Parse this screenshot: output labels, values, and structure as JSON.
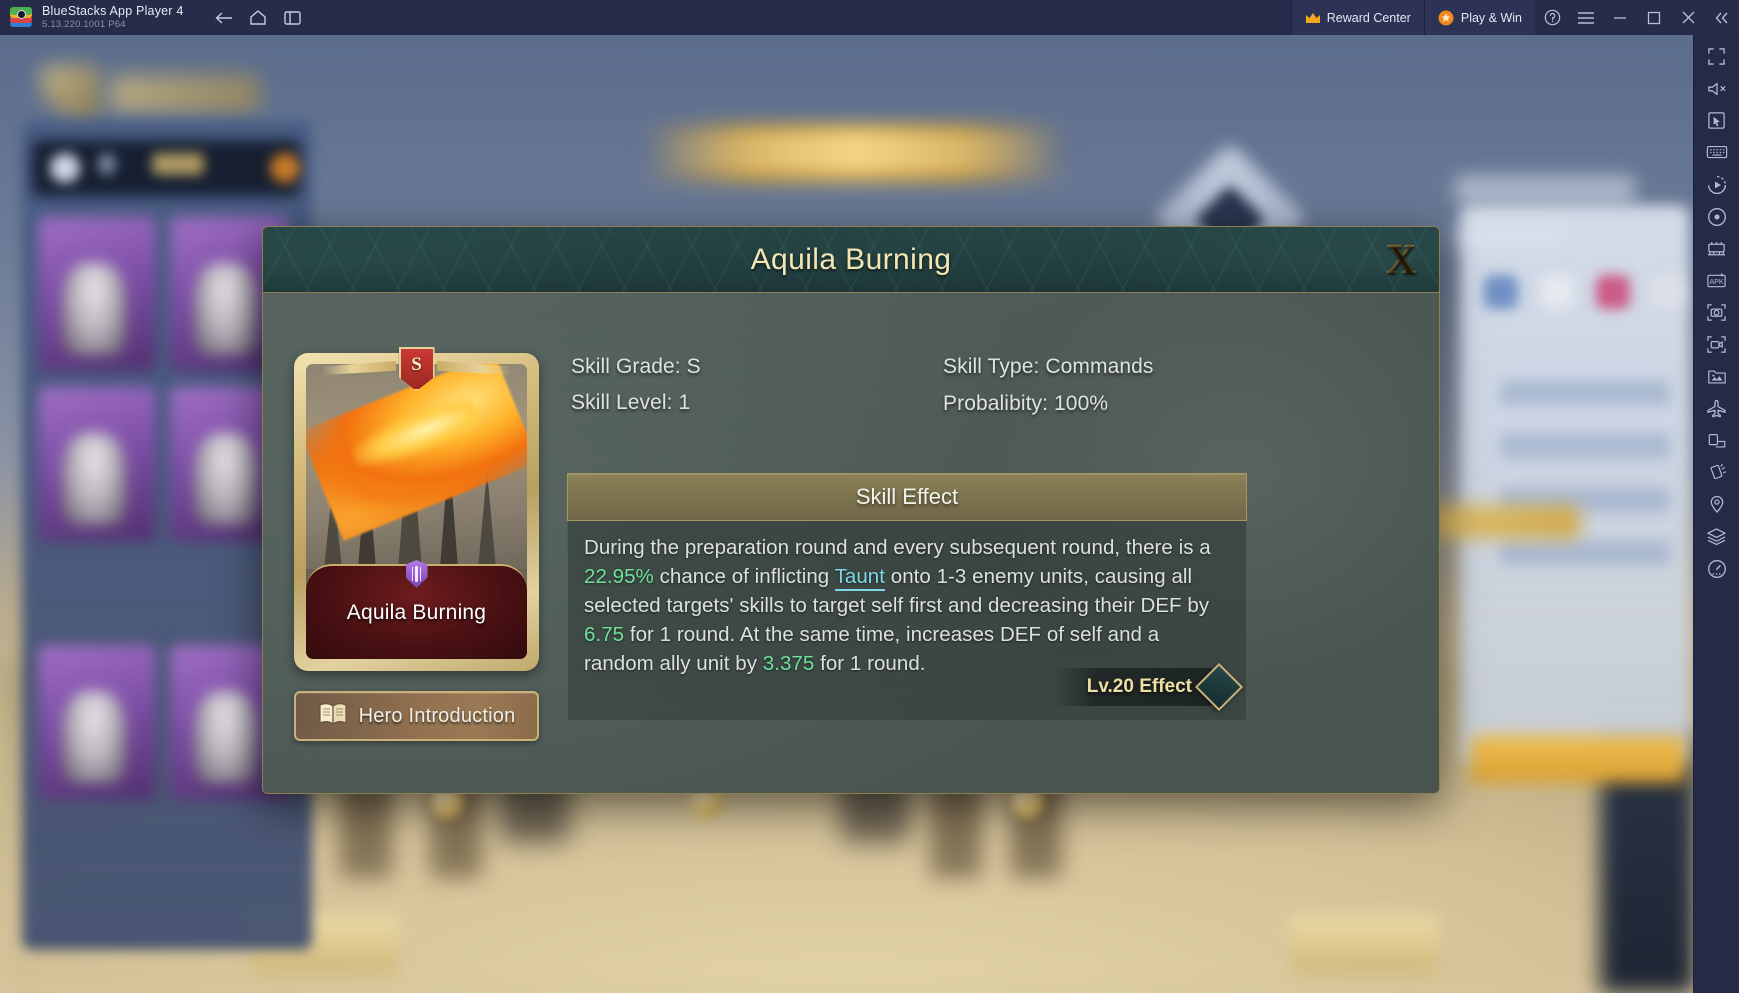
{
  "titlebar": {
    "app_name": "BlueStacks App Player 4",
    "version": "5.13.220.1001 P64",
    "nav": [
      {
        "name": "back-button",
        "icon": "arrow-left-icon"
      },
      {
        "name": "home-button",
        "icon": "home-icon"
      },
      {
        "name": "multi-window-button",
        "icon": "windows-icon"
      }
    ],
    "reward_center": "Reward Center",
    "play_and_win": "Play & Win",
    "window_controls": [
      {
        "name": "help-button",
        "icon": "question-circle-icon"
      },
      {
        "name": "menu-button",
        "icon": "hamburger-icon"
      },
      {
        "name": "minimize-button",
        "icon": "minimize-icon"
      },
      {
        "name": "maximize-button",
        "icon": "maximize-icon"
      },
      {
        "name": "close-button",
        "icon": "close-icon"
      },
      {
        "name": "collapse-sidebar-button",
        "icon": "chevron-double-left-icon"
      }
    ],
    "colors": {
      "bg": "#262c4a",
      "text": "#e7eaf2",
      "subtext": "#8a90ad",
      "pill_bg": "#2c3354"
    }
  },
  "sidebar": {
    "items": [
      {
        "name": "fullscreen-tool",
        "icon": "fullscreen-icon"
      },
      {
        "name": "volume-tool",
        "icon": "speaker-mute-icon"
      },
      {
        "name": "cursor-tool",
        "icon": "cursor-icon"
      },
      {
        "name": "keyboard-controls-tool",
        "icon": "keyboard-icon"
      },
      {
        "name": "macro-tool",
        "icon": "play-circle-icon"
      },
      {
        "name": "record-tool",
        "icon": "record-circle-icon"
      },
      {
        "name": "multi-instance-tool",
        "icon": "multi-instance-icon"
      },
      {
        "name": "install-apk-tool",
        "icon": "apk-icon"
      },
      {
        "name": "screenshot-tool",
        "icon": "camera-icon"
      },
      {
        "name": "screen-record-tool",
        "icon": "video-camera-icon"
      },
      {
        "name": "media-manager-tool",
        "icon": "gallery-icon"
      },
      {
        "name": "eco-mode-tool",
        "icon": "airplane-icon"
      },
      {
        "name": "rotate-tool",
        "icon": "rotate-screen-icon"
      },
      {
        "name": "shake-tool",
        "icon": "shake-icon"
      },
      {
        "name": "location-tool",
        "icon": "location-pin-icon"
      },
      {
        "name": "layers-tool",
        "icon": "layers-icon"
      },
      {
        "name": "performance-tool",
        "icon": "gauge-icon"
      }
    ]
  },
  "dialog": {
    "title": "Aquila Burning",
    "close_label": "X",
    "card": {
      "grade_badge": "S",
      "name": "Aquila Burning"
    },
    "hero_intro_button": "Hero Introduction",
    "stats": {
      "skill_grade": "Skill Grade: S",
      "skill_level": "Skill Level: 1",
      "skill_type": "Skill Type: Commands",
      "probability": "Probalibity: 100%"
    },
    "skill_effect_header": "Skill Effect",
    "skill_description": {
      "segments": [
        {
          "text": "During the preparation round and every subsequent round, there is a ",
          "style": "normal"
        },
        {
          "text": "22.95%",
          "style": "value"
        },
        {
          "text": " chance of inflicting ",
          "style": "normal"
        },
        {
          "text": "Taunt",
          "style": "keyword"
        },
        {
          "text": " onto 1-3 enemy units, causing all selected targets' skills to target self first and decreasing their DEF by ",
          "style": "normal"
        },
        {
          "text": "6.75",
          "style": "value"
        },
        {
          "text": " for 1 round. At the same time, increases DEF of self and a random ally unit by ",
          "style": "normal"
        },
        {
          "text": "3.375",
          "style": "value"
        },
        {
          "text": " for 1 round.",
          "style": "normal"
        }
      ]
    },
    "lv_effect_button": "Lv.20 Effect",
    "colors": {
      "header_bg": "#17302f",
      "title_gold": "#f4e6b4",
      "border_gold": "#8d7f4e",
      "body_bg": "#4c5854",
      "effect_header_bg": "#7d7450",
      "value_green": "#6ee29a",
      "keyword_cyan": "#7fd7e8",
      "hero_button_bronze": "#8f6f4e"
    }
  }
}
